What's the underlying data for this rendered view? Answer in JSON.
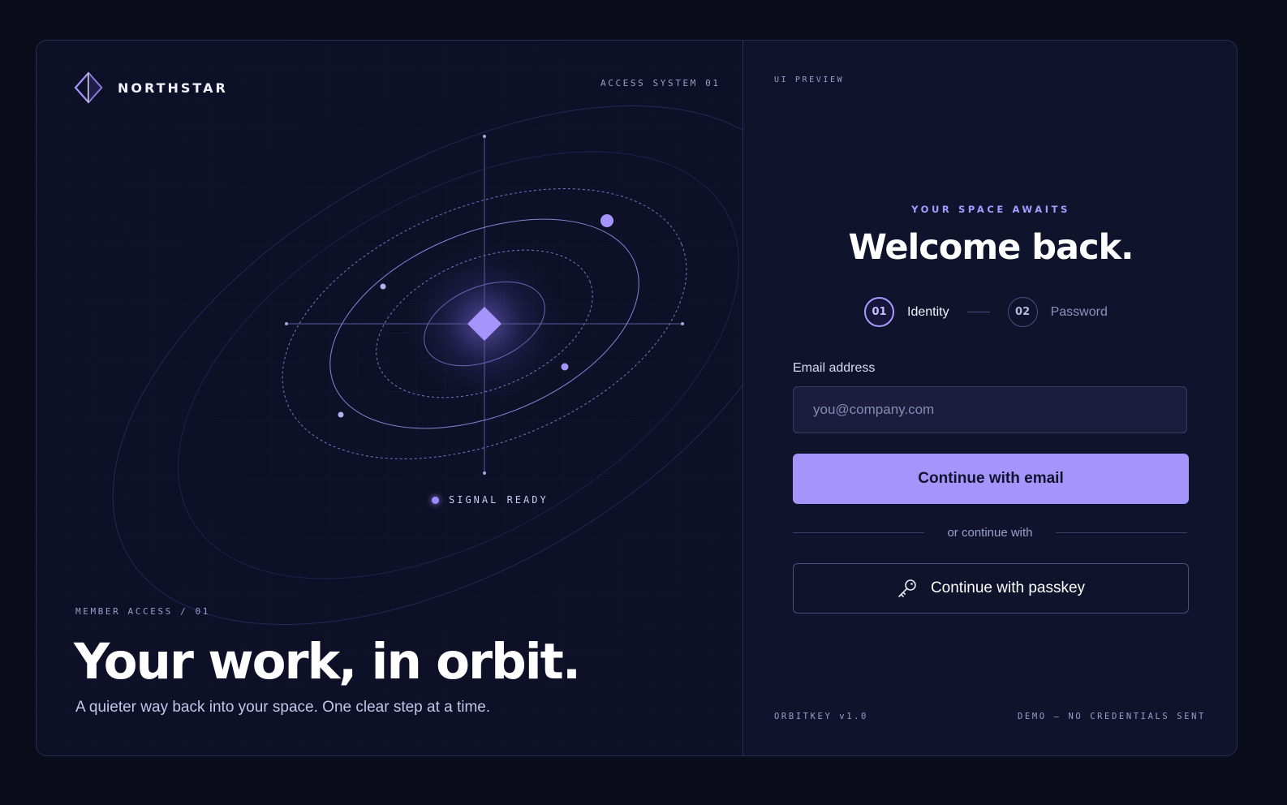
{
  "brand": {
    "name": "NORTHSTAR",
    "logo_icon": "diamond-outline-icon"
  },
  "left": {
    "system_label": "ACCESS SYSTEM 01",
    "signal_label": "SIGNAL READY",
    "eyebrow": "MEMBER ACCESS / 01",
    "headline": "Your work, in orbit.",
    "subtext": "A quieter way back into your space. One clear step at a time."
  },
  "right": {
    "preview_label": "UI PREVIEW",
    "eyebrow": "YOUR SPACE AWAITS",
    "title": "Welcome back.",
    "steps": [
      {
        "number": "01",
        "label": "Identity",
        "active": true
      },
      {
        "number": "02",
        "label": "Password",
        "active": false
      }
    ],
    "email": {
      "label": "Email address",
      "placeholder": "you@company.com",
      "value": ""
    },
    "primary_button": "Continue with email",
    "divider_text": "or continue with",
    "passkey_button": "Continue with passkey",
    "footer_left": "ORBITKEY v1.0",
    "footer_right": "DEMO — NO CREDENTIALS SENT"
  },
  "colors": {
    "background": "#0a0c1a",
    "panel": "#0f132c",
    "accent": "#a595fb",
    "border": "#2a2f55"
  }
}
